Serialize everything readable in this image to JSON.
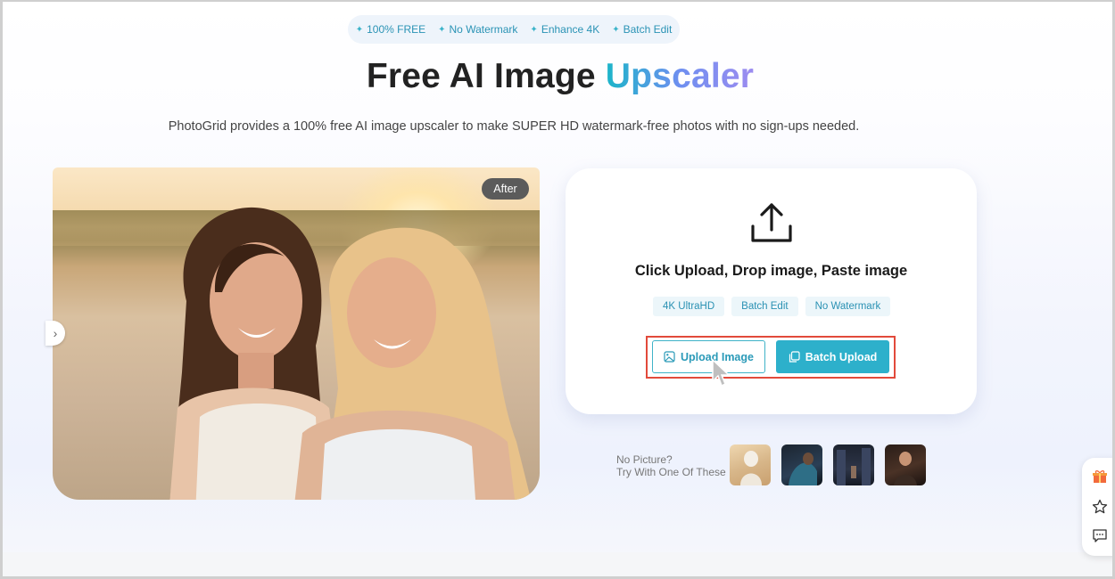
{
  "top_features": [
    {
      "label": "100% FREE"
    },
    {
      "label": "No Watermark"
    },
    {
      "label": "Enhance 4K"
    },
    {
      "label": "Batch Edit"
    }
  ],
  "hero": {
    "title_main": "Free AI Image ",
    "title_highlight": "Upscaler",
    "subtitle": "PhotoGrid provides a 100% free AI image upscaler to make SUPER HD watermark-free photos with no sign-ups needed."
  },
  "preview": {
    "badge": "After"
  },
  "upload": {
    "heading": "Click Upload, Drop image, Paste image",
    "tags": [
      "4K UltraHD",
      "Batch Edit",
      "No Watermark"
    ],
    "upload_button": "Upload Image",
    "batch_button": "Batch Upload"
  },
  "samples": {
    "line1": "No Picture?",
    "line2": "Try With One Of These"
  },
  "side_tools": [
    "gift-icon",
    "star-icon",
    "feedback-icon"
  ],
  "colors": {
    "accent": "#2db0cb",
    "highlight_border": "#e24a3b"
  }
}
